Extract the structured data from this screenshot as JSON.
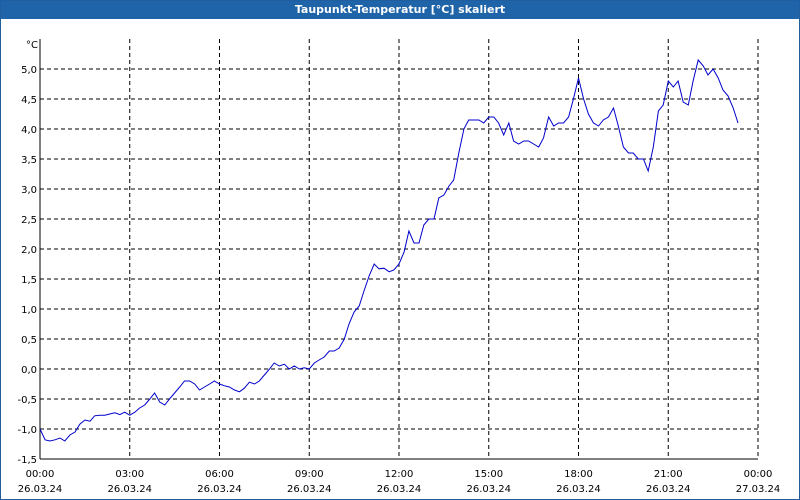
{
  "title": "Taupunkt-Temperatur [°C] skaliert",
  "colors": {
    "title_bar": "#1f64a8",
    "line": "#0000cc",
    "grid": "#000000"
  },
  "chart_data": {
    "type": "line",
    "title": "Taupunkt-Temperatur [°C] skaliert",
    "ylabel": "°C",
    "xlabel": "",
    "ylim": [
      -1.5,
      5.5
    ],
    "xlim_hours": [
      0,
      24
    ],
    "grid": true,
    "y_ticks": [
      "5,0",
      "4,5",
      "4,0",
      "3,5",
      "3,0",
      "2,5",
      "2,0",
      "1,5",
      "1,0",
      "0,5",
      "0,0",
      "-0,5",
      "-1,0",
      "-1,5"
    ],
    "y_tick_values": [
      5.0,
      4.5,
      4.0,
      3.5,
      3.0,
      2.5,
      2.0,
      1.5,
      1.0,
      0.5,
      0.0,
      -0.5,
      -1.0,
      -1.5
    ],
    "x_ticks": [
      {
        "time": "00:00",
        "date": "26.03.24"
      },
      {
        "time": "03:00",
        "date": "26.03.24"
      },
      {
        "time": "06:00",
        "date": "26.03.24"
      },
      {
        "time": "09:00",
        "date": "26.03.24"
      },
      {
        "time": "12:00",
        "date": "26.03.24"
      },
      {
        "time": "15:00",
        "date": "26.03.24"
      },
      {
        "time": "18:00",
        "date": "26.03.24"
      },
      {
        "time": "21:00",
        "date": "26.03.24"
      },
      {
        "time": "00:00",
        "date": "27.03.24"
      }
    ],
    "series": [
      {
        "hours": [
          0,
          0.17,
          0.33,
          0.5,
          0.67,
          0.83,
          1.0,
          1.17,
          1.33,
          1.5,
          1.67,
          1.83,
          2.0,
          2.17,
          2.33,
          2.5,
          2.67,
          2.83,
          3.0,
          3.17,
          3.33,
          3.5,
          3.67,
          3.83,
          4.0,
          4.17,
          4.33,
          4.5,
          4.67,
          4.83,
          5.0,
          5.17,
          5.33,
          5.5,
          5.67,
          5.83,
          6.0,
          6.17,
          6.33,
          6.5,
          6.67,
          6.83,
          7.0,
          7.17,
          7.33,
          7.5,
          7.67,
          7.83,
          8.0,
          8.17,
          8.33,
          8.5,
          8.67,
          8.83,
          9.0,
          9.17,
          9.33,
          9.5,
          9.67,
          9.83,
          10.0,
          10.17,
          10.33,
          10.5,
          10.67,
          10.83,
          11.0,
          11.17,
          11.33,
          11.5,
          11.67,
          11.83,
          12.0,
          12.17,
          12.33,
          12.5,
          12.67,
          12.83,
          13.0,
          13.17,
          13.33,
          13.5,
          13.67,
          13.83,
          14.0,
          14.17,
          14.33,
          14.5,
          14.67,
          14.83,
          15.0,
          15.17,
          15.33,
          15.5,
          15.67,
          15.83,
          16.0,
          16.17,
          16.33,
          16.5,
          16.67,
          16.83,
          17.0,
          17.17,
          17.33,
          17.5,
          17.67,
          17.83,
          18.0,
          18.17,
          18.33,
          18.5,
          18.67,
          18.83,
          19.0,
          19.17,
          19.33,
          19.5,
          19.67,
          19.83,
          20.0,
          20.17,
          20.33,
          20.5,
          20.67,
          20.83,
          21.0,
          21.17,
          21.33,
          21.5,
          21.67,
          21.83,
          22.0,
          22.17,
          22.33,
          22.5,
          22.67,
          22.83,
          23.0,
          23.17,
          23.33,
          23.5,
          23.67,
          23.83,
          24.0
        ],
        "values": [
          -1.0,
          -1.18,
          -1.2,
          -1.18,
          -1.15,
          -1.2,
          -1.1,
          -1.05,
          -0.92,
          -0.85,
          -0.87,
          -0.78,
          -0.77,
          -0.77,
          -0.75,
          -0.73,
          -0.76,
          -0.72,
          -0.77,
          -0.72,
          -0.65,
          -0.6,
          -0.5,
          -0.4,
          -0.55,
          -0.6,
          -0.5,
          -0.4,
          -0.3,
          -0.2,
          -0.2,
          -0.25,
          -0.35,
          -0.3,
          -0.25,
          -0.2,
          -0.25,
          -0.28,
          -0.3,
          -0.35,
          -0.38,
          -0.32,
          -0.22,
          -0.25,
          -0.2,
          -0.1,
          0.0,
          0.1,
          0.05,
          0.08,
          0.0,
          0.05,
          0.0,
          0.02,
          0.0,
          0.1,
          0.15,
          0.2,
          0.3,
          0.3,
          0.35,
          0.5,
          0.75,
          0.95,
          1.05,
          1.3,
          1.55,
          1.75,
          1.67,
          1.68,
          1.62,
          1.65,
          1.75,
          1.95,
          2.3,
          2.1,
          2.1,
          2.4,
          2.5,
          2.5,
          2.85,
          2.9,
          3.05,
          3.15,
          3.6,
          4.0,
          4.15,
          4.15,
          4.15,
          4.1,
          4.2,
          4.2,
          4.1,
          3.9,
          4.1,
          3.8,
          3.75,
          3.8,
          3.8,
          3.75,
          3.7,
          3.85,
          4.2,
          4.05,
          4.1,
          4.1,
          4.2,
          4.5,
          4.85,
          4.5,
          4.25,
          4.1,
          4.05,
          4.15,
          4.2,
          4.35,
          4.05,
          3.7,
          3.6,
          3.6,
          3.5,
          3.5,
          3.3,
          3.7,
          4.3,
          4.4,
          4.8,
          4.7,
          4.8,
          4.45,
          4.4,
          4.8,
          5.15,
          5.05,
          4.9,
          5.0,
          4.85,
          4.65,
          4.55,
          4.35,
          4.1
        ]
      }
    ]
  }
}
